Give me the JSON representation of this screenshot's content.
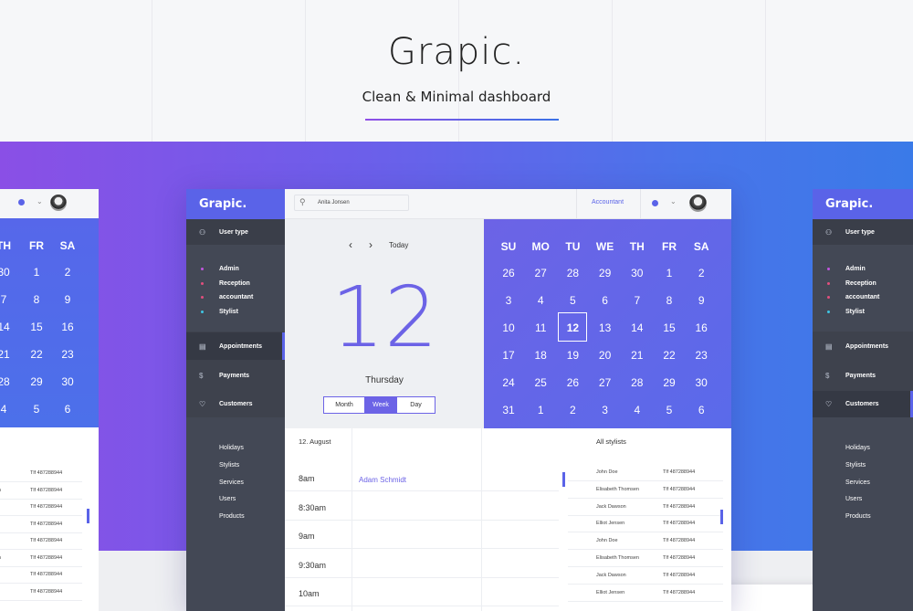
{
  "hero": {
    "title": "Grapic.",
    "subtitle": "Clean & Minimal dashboard"
  },
  "colors": {
    "accent": "#5a63e8",
    "sidebar": "#434855",
    "band_start": "#8a4fe6",
    "band_end": "#3a7ae8"
  },
  "app": {
    "logo": "Grapic.",
    "search_value": "Anita Jonsen",
    "role_label": "Accountant",
    "sidebar": {
      "user_type_label": "User type",
      "user_types": [
        {
          "label": "Admin",
          "color": "#c256e0"
        },
        {
          "label": "Reception",
          "color": "#e24f7e"
        },
        {
          "label": "accountant",
          "color": "#e24f7e"
        },
        {
          "label": "Stylist",
          "color": "#3ec6e4"
        }
      ],
      "nav": [
        {
          "label": "Appointments",
          "icon": "calendar-icon"
        },
        {
          "label": "Payments",
          "icon": "dollar-icon"
        },
        {
          "label": "Customers",
          "icon": "heart-icon"
        }
      ],
      "links": [
        "Holidays",
        "Stylists",
        "Services",
        "Users",
        "Products"
      ]
    },
    "day_panel": {
      "prev_icon": "‹",
      "next_icon": "›",
      "today_label": "Today",
      "big_date": "12",
      "weekday": "Thursday",
      "views": [
        "Month",
        "Week",
        "Day"
      ],
      "active_view": "Week"
    },
    "month_calendar": {
      "headers": [
        "SU",
        "MO",
        "TU",
        "WE",
        "TH",
        "FR",
        "SA"
      ],
      "weeks": [
        [
          "26",
          "27",
          "28",
          "29",
          "30",
          "1",
          "2"
        ],
        [
          "3",
          "4",
          "5",
          "6",
          "7",
          "8",
          "9"
        ],
        [
          "10",
          "11",
          "12",
          "13",
          "14",
          "15",
          "16"
        ],
        [
          "17",
          "18",
          "19",
          "20",
          "21",
          "22",
          "23"
        ],
        [
          "24",
          "25",
          "26",
          "27",
          "28",
          "29",
          "30"
        ],
        [
          "31",
          "1",
          "2",
          "3",
          "4",
          "5",
          "6"
        ]
      ],
      "selected": "12"
    },
    "schedule": {
      "date_label": "12. August",
      "times": [
        "8am",
        "8:30am",
        "9am",
        "9:30am",
        "10am"
      ],
      "event": "Adam Schmidt"
    },
    "stylists": {
      "header": "All stylists",
      "rows": [
        {
          "name": "John Doe",
          "phone": "Tlf 487288944"
        },
        {
          "name": "Elisabeth Thomsen",
          "phone": "Tlf 487288944"
        },
        {
          "name": "Jack Dawson",
          "phone": "Tlf 487288944"
        },
        {
          "name": "Elliot Jensen",
          "phone": "Tlf 487288944"
        },
        {
          "name": "John Doe",
          "phone": "Tlf 487288944"
        },
        {
          "name": "Elisabeth Thomsen",
          "phone": "Tlf 487288944"
        },
        {
          "name": "Jack Dawson",
          "phone": "Tlf 487288944"
        },
        {
          "name": "Elliot Jensen",
          "phone": "Tlf 487288944"
        }
      ]
    }
  },
  "left_preview": {
    "headers": [
      "TH",
      "FR",
      "SA"
    ],
    "rows": [
      [
        "30",
        "1",
        "2"
      ],
      [
        "7",
        "8",
        "9"
      ],
      [
        "14",
        "15",
        "16"
      ],
      [
        "21",
        "22",
        "23"
      ],
      [
        "28",
        "29",
        "30"
      ],
      [
        "4",
        "5",
        "6"
      ]
    ],
    "phones": [
      "Tlf 487288944",
      "Tlf 487288944",
      "Tlf 487288944",
      "Tlf 487288944",
      "Tlf 487288944",
      "Tlf 487288944",
      "Tlf 487288944",
      "Tlf 487288944"
    ],
    "names": [
      "",
      "n",
      "",
      "",
      "",
      "n",
      "",
      ""
    ]
  },
  "right_preview": {
    "logo": "Grapic.",
    "user_type_label": "User type",
    "user_types": [
      {
        "label": "Admin",
        "color": "#c256e0"
      },
      {
        "label": "Reception",
        "color": "#e24f7e"
      },
      {
        "label": "accountant",
        "color": "#e24f7e"
      },
      {
        "label": "Stylist",
        "color": "#3ec6e4"
      }
    ],
    "nav": [
      "Appointments",
      "Payments",
      "Customers"
    ],
    "links": [
      "Holidays",
      "Stylists",
      "Services",
      "Users",
      "Products"
    ]
  }
}
